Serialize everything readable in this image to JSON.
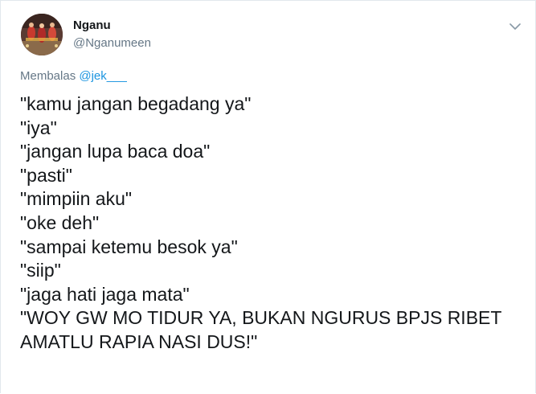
{
  "author": {
    "display_name": "Nganu",
    "handle": "@Nganumeen",
    "avatar": "profile-photo"
  },
  "menu_icon": "chevron-down-icon",
  "reply": {
    "prefix": "Membalas",
    "mention": "@jek___"
  },
  "tweet": {
    "lines": [
      "\"kamu jangan begadang ya\"",
      "\"iya\"",
      "\"jangan lupa baca doa\"",
      "\"pasti\"",
      "\"mimpiin aku\"",
      "\"oke deh\"",
      "\"sampai ketemu besok ya\"",
      "\"siip\"",
      "\"jaga hati jaga mata\"",
      "\"WOY GW MO TIDUR YA, BUKAN NGURUS BPJS RIBET",
      "AMATLU RAPIA NASI DUS!\""
    ]
  },
  "colors": {
    "text": "#14171a",
    "secondary": "#657786",
    "link": "#1b95e0",
    "border": "#e1e8ed"
  }
}
